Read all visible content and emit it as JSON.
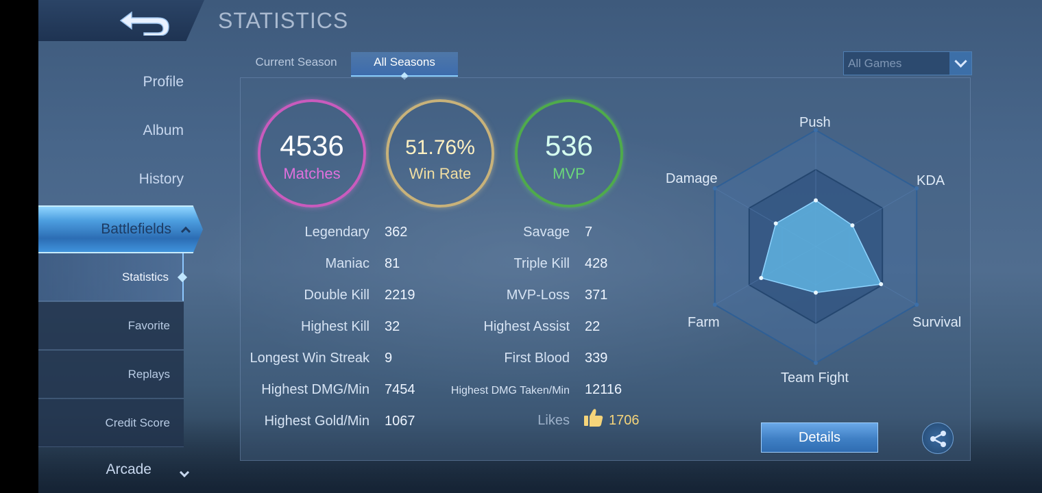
{
  "header": {
    "title": "STATISTICS"
  },
  "sidebar": {
    "items": [
      {
        "label": "Profile"
      },
      {
        "label": "Album"
      },
      {
        "label": "History"
      },
      {
        "label": "Battlefields"
      },
      {
        "label": "Arcade"
      }
    ],
    "active": "Battlefields",
    "subitems": [
      {
        "label": "Statistics"
      },
      {
        "label": "Favorite"
      },
      {
        "label": "Replays"
      },
      {
        "label": "Credit Score"
      }
    ],
    "active_subitem": "Statistics"
  },
  "tabs": [
    {
      "label": "Current Season"
    },
    {
      "label": "All Seasons"
    }
  ],
  "active_tab": "All Seasons",
  "filter": {
    "selected": "All Games"
  },
  "summary": {
    "matches": {
      "value": "4536",
      "label": "Matches"
    },
    "win_rate": {
      "value": "51.76%",
      "label": "Win Rate"
    },
    "mvp": {
      "value": "536",
      "label": "MVP"
    }
  },
  "stats_left": [
    {
      "label": "Legendary",
      "value": "362"
    },
    {
      "label": "Maniac",
      "value": "81"
    },
    {
      "label": "Double Kill",
      "value": "2219"
    },
    {
      "label": "Highest Kill",
      "value": "32"
    },
    {
      "label": "Longest Win Streak",
      "value": "9"
    },
    {
      "label": "Highest DMG/Min",
      "value": "7454"
    },
    {
      "label": "Highest Gold/Min",
      "value": "1067"
    }
  ],
  "stats_right": [
    {
      "label": "Savage",
      "value": "7"
    },
    {
      "label": "Triple Kill",
      "value": "428"
    },
    {
      "label": "MVP-Loss",
      "value": "371"
    },
    {
      "label": "Highest Assist",
      "value": "22"
    },
    {
      "label": "First Blood",
      "value": "339"
    },
    {
      "label": "Highest DMG Taken/Min",
      "value": "12116"
    },
    {
      "label": "Likes",
      "value": "1706"
    }
  ],
  "radar": {
    "axes": [
      "Push",
      "KDA",
      "Survival",
      "Team Fight",
      "Farm",
      "Damage"
    ],
    "values": [
      0.6,
      0.55,
      0.98,
      0.6,
      0.82,
      0.6
    ]
  },
  "buttons": {
    "details": "Details"
  },
  "icons": {
    "back": "back-arrow-icon",
    "share": "share-icon",
    "likes": "thumbs-up-icon",
    "dropdown": "chevron-down-icon"
  },
  "colors": {
    "matches": "#c95bbd",
    "win_rate": "#c8b27a",
    "mvp": "#4fab4b",
    "radar_fill": "#5fb3e0",
    "accent": "#4d9fe0"
  }
}
